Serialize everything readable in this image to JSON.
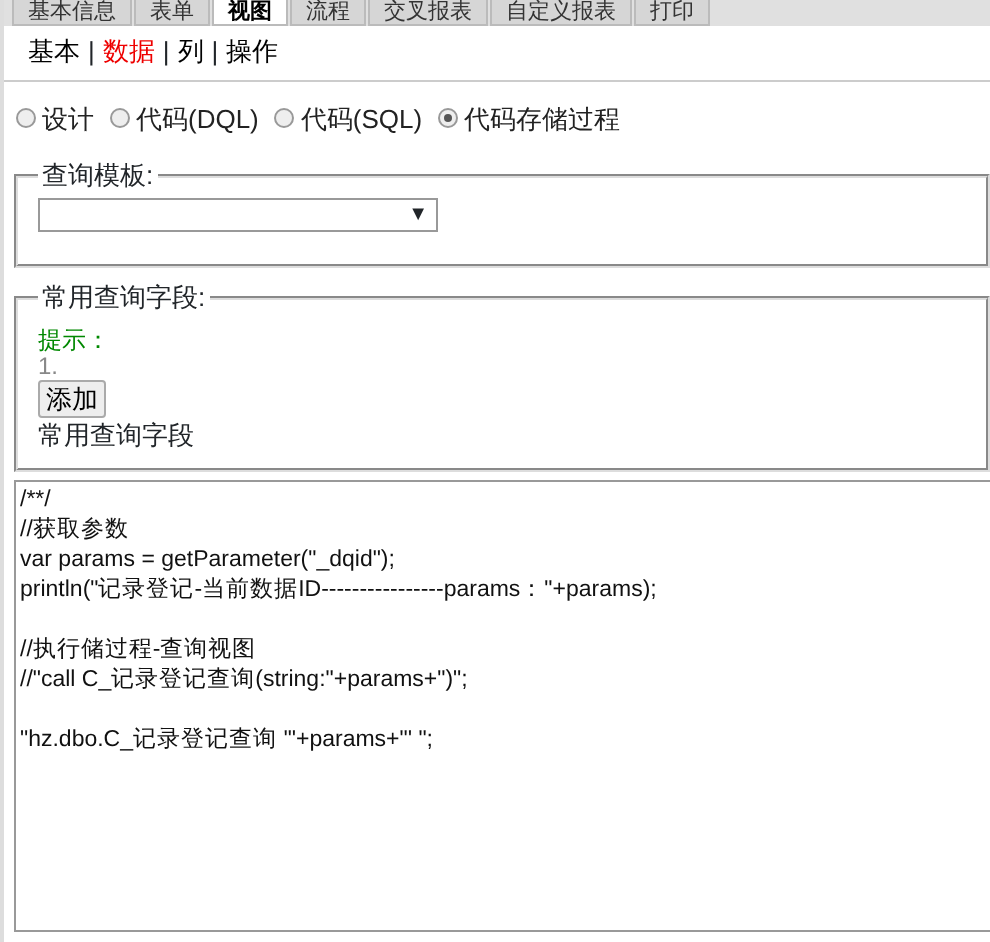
{
  "top_tabs": [
    {
      "label": "基本信息",
      "selected": false
    },
    {
      "label": "表单",
      "selected": false
    },
    {
      "label": "视图",
      "selected": true
    },
    {
      "label": "流程",
      "selected": false
    },
    {
      "label": "交叉报表",
      "selected": false
    },
    {
      "label": "自定义报表",
      "selected": false
    },
    {
      "label": "打印",
      "selected": false
    }
  ],
  "sub_tabs": [
    {
      "label": "基本",
      "selected": false
    },
    {
      "label": "数据",
      "selected": true
    },
    {
      "label": "列",
      "selected": false
    },
    {
      "label": "操作",
      "selected": false
    }
  ],
  "separator": "|",
  "modes": [
    {
      "label": "设计",
      "selected": false
    },
    {
      "label": "代码(DQL)",
      "selected": false
    },
    {
      "label": "代码(SQL)",
      "selected": false
    },
    {
      "label": "代码存储过程",
      "selected": true
    }
  ],
  "template_group": {
    "legend": "查询模板:",
    "select_arrow": "▼"
  },
  "fields_group": {
    "legend": "常用查询字段:",
    "hint": "提示：",
    "hint_item": "1.",
    "add_button": "添加",
    "caption": "常用查询字段"
  },
  "code_blocks": [
    [
      "/**/",
      "//获取参数",
      "var params = getParameter(\"_dqid\");",
      "println(\"记录登记-当前数据ID----------------params：\"+params);"
    ],
    [
      "//执行储过程-查询视图",
      "//\"call C_记录登记查询(string:\"+params+\")\";"
    ],
    [
      "\"hz.dbo.C_记录登记查询 '\"+params+\"' \";"
    ]
  ]
}
